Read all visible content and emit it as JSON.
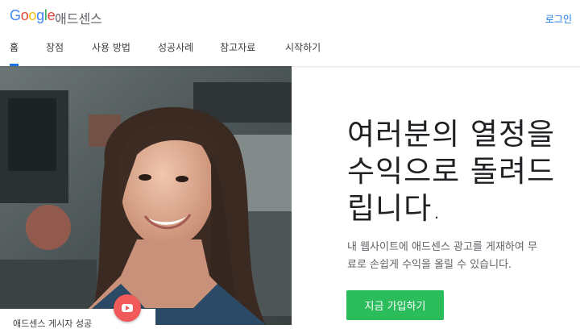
{
  "header": {
    "logo_text": "Google",
    "product_name": "애드센스",
    "login_label": "로그인",
    "brand_colors": [
      "#4285f4",
      "#ea4335",
      "#fbbc05",
      "#34a853"
    ]
  },
  "nav": {
    "items": [
      {
        "label": "홈",
        "active": true
      },
      {
        "label": "장점",
        "active": false
      },
      {
        "label": "사용 방법",
        "active": false
      },
      {
        "label": "성공사례",
        "active": false
      },
      {
        "label": "참고자료",
        "active": false
      },
      {
        "label": "시작하기",
        "active": false
      }
    ],
    "accent_color": "#1a73e8"
  },
  "hero": {
    "headline_line1": "여러분의 열정을",
    "headline_line2": "수익으로 돌려드",
    "headline_line3": "립니다.",
    "subtext_line1": "내 웹사이트에 애드센스 광고를 게재하여 무",
    "subtext_line2": "료로 손쉽게 수익을 올릴 수 있습니다.",
    "cta_label": "지금 가입하기",
    "cta_color": "#2bbd5c",
    "video_caption": "애드센스 게시자 성공",
    "play_icon": "youtube-play-icon"
  }
}
